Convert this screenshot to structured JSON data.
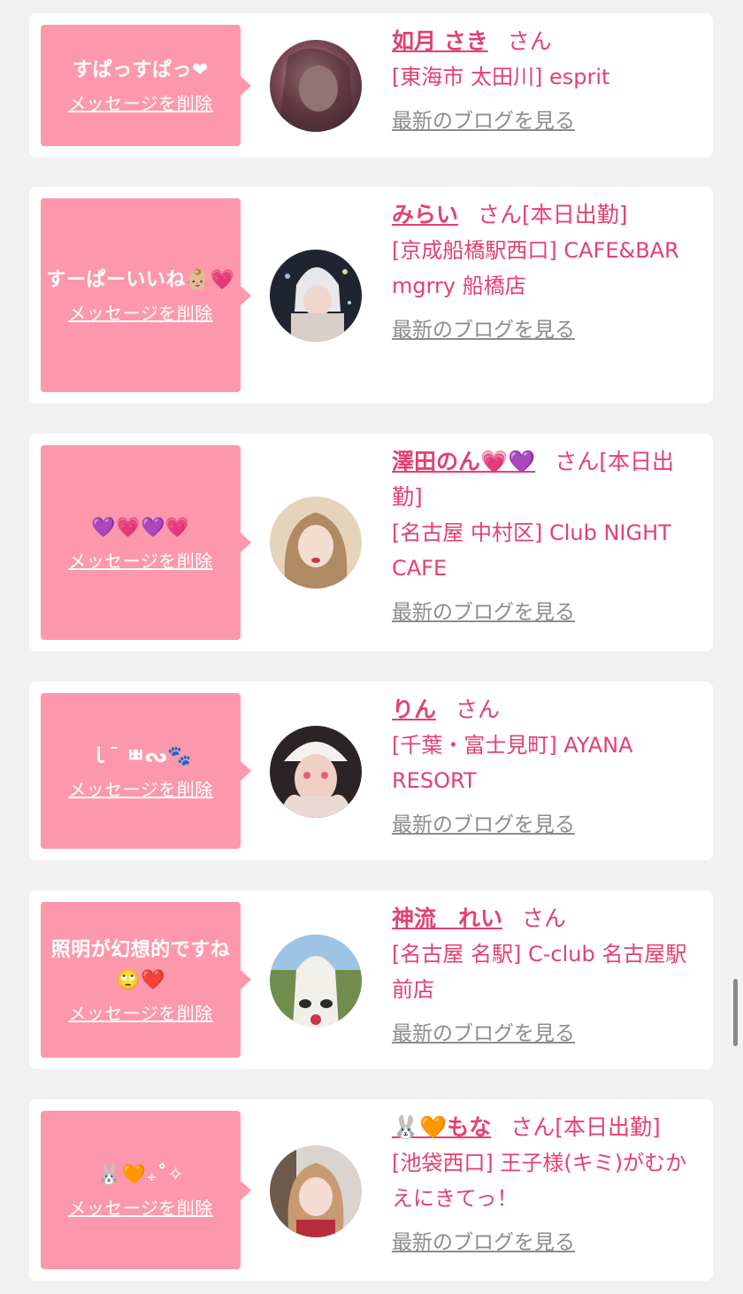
{
  "delete_label": "メッセージを削除",
  "blog_label": "最新のブログを見る",
  "san_label": "さん",
  "messages": [
    {
      "text": "すぱっすぱっ❤",
      "name": "如月 さき",
      "status": "",
      "shop": "[東海市 太田川] esprit"
    },
    {
      "text": "すーぱーいいね👶🏼💗",
      "name": "みらい",
      "status": "[本日出勤]",
      "shop": "[京成船橋駅西口] CAFE&BAR mgrry 船橋店"
    },
    {
      "text": "💜💗💜💗",
      "name": "澤田のん💗💜",
      "status": "[本日出勤]",
      "shop": "[名古屋 中村区] Club NIGHT CAFE"
    },
    {
      "text": "ｌ¯ ㅃᔓ🐾",
      "name": "りん",
      "status": "",
      "shop": "[千葉・富士見町] AYANA RESORT"
    },
    {
      "text": "照明が幻想的ですね🙄❤️",
      "name": "神流　れい",
      "status": "",
      "shop": "[名古屋 名駅] C-club 名古屋駅前店"
    },
    {
      "text": "🐰🧡₊˚✧",
      "name": "🐰🧡もな",
      "status": "[本日出勤]",
      "shop": "[池袋西口] 王子様(キミ)がむかえにきてっ！"
    }
  ],
  "colors": {
    "accent": "#e44072",
    "bubble": "#fd98ac",
    "background": "#f1f1f1",
    "link_gray": "#8c8c8c"
  }
}
